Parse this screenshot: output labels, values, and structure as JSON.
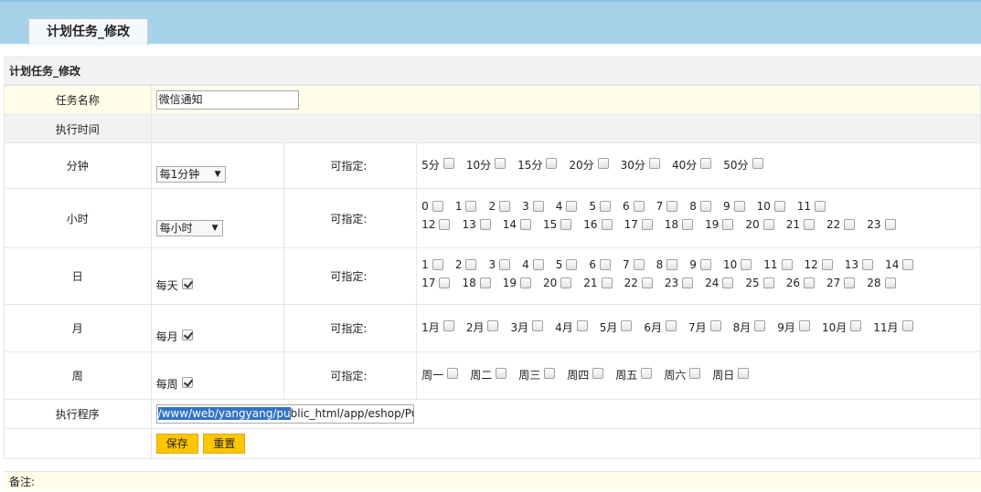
{
  "tab": {
    "title": "计划任务_修改"
  },
  "section": {
    "title": "计划任务_修改"
  },
  "task_name": {
    "label": "任务名称",
    "value": "微信通知"
  },
  "exec_time": {
    "label": "执行时间"
  },
  "minute": {
    "label": "分钟",
    "select": "每1分钟",
    "spec_label": "可指定:",
    "options": [
      "5分",
      "10分",
      "15分",
      "20分",
      "30分",
      "40分",
      "50分"
    ]
  },
  "hour": {
    "label": "小时",
    "select": "每小时",
    "spec_label": "可指定:",
    "options_row1": [
      "0",
      "1",
      "2",
      "3",
      "4",
      "5",
      "6",
      "7",
      "8",
      "9",
      "10",
      "11"
    ],
    "options_row2": [
      "12",
      "13",
      "14",
      "15",
      "16",
      "17",
      "18",
      "19",
      "20",
      "21",
      "22",
      "23"
    ]
  },
  "day": {
    "label": "日",
    "every": "每天",
    "spec_label": "可指定:",
    "options_row1": [
      "1",
      "2",
      "3",
      "4",
      "5",
      "6",
      "7",
      "8",
      "9",
      "10",
      "11",
      "12",
      "13",
      "14"
    ],
    "options_row2": [
      "17",
      "18",
      "19",
      "20",
      "21",
      "22",
      "23",
      "24",
      "25",
      "26",
      "27",
      "28"
    ]
  },
  "month": {
    "label": "月",
    "every": "每月",
    "spec_label": "可指定:",
    "options": [
      "1月",
      "2月",
      "3月",
      "4月",
      "5月",
      "6月",
      "7月",
      "8月",
      "9月",
      "10月",
      "11月"
    ]
  },
  "week": {
    "label": "周",
    "every": "每周",
    "spec_label": "可指定:",
    "options": [
      "周一",
      "周二",
      "周三",
      "周四",
      "周五",
      "周六",
      "周日"
    ]
  },
  "program": {
    "label": "执行程序",
    "value_selected": "/www/web/yangyang/pu",
    "value_rest": "blic_html/app/eshop/Public"
  },
  "buttons": {
    "save": "保存",
    "reset": "重置"
  },
  "note": {
    "label": "备注:"
  }
}
